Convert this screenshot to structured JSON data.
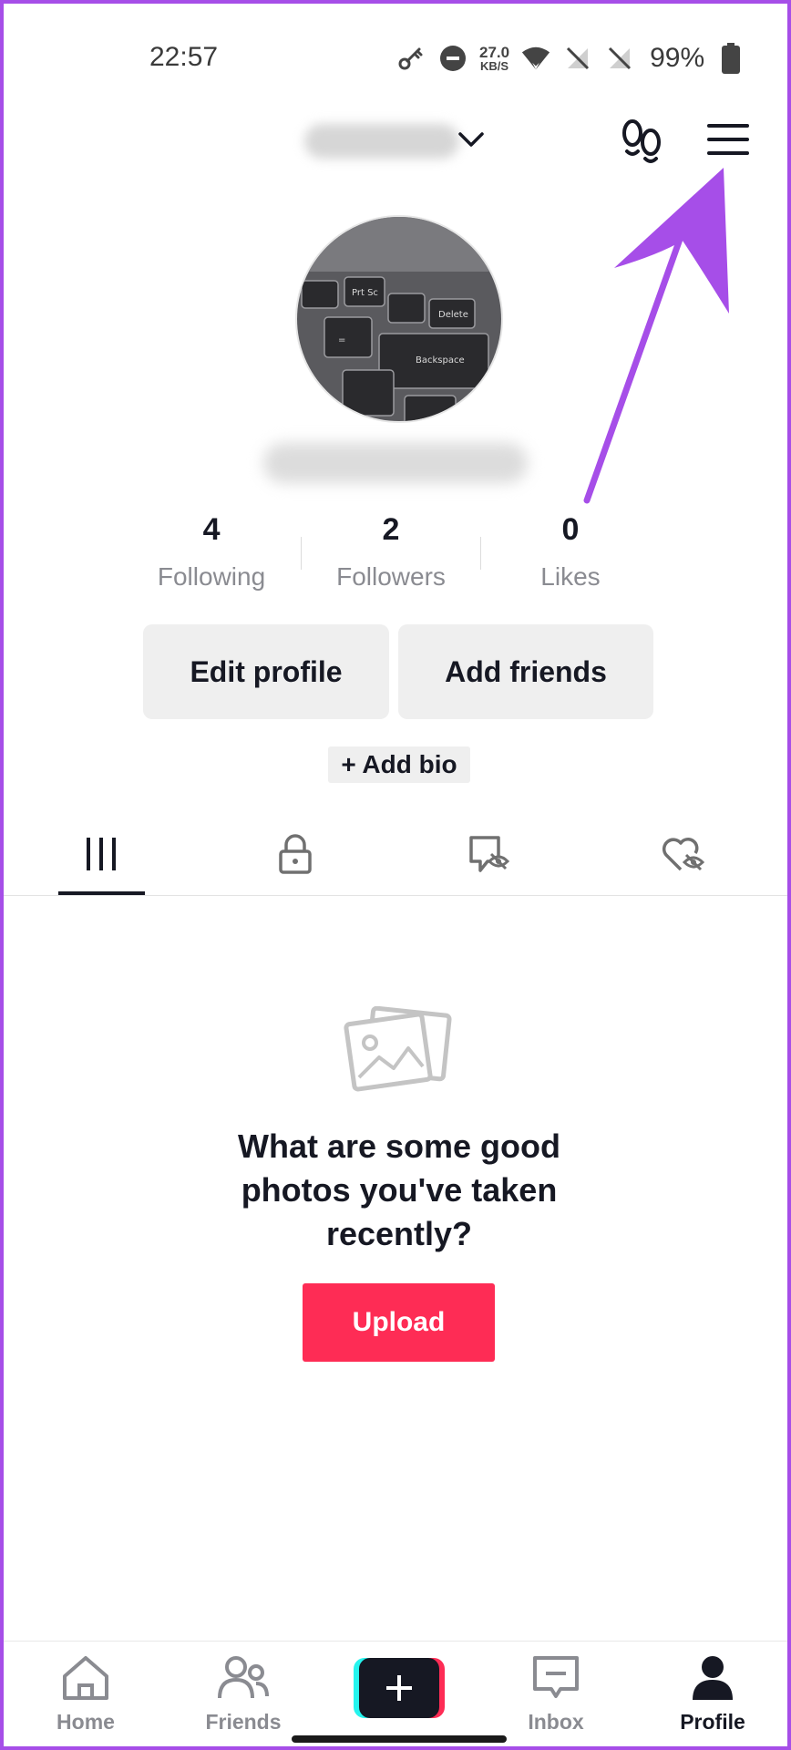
{
  "status_bar": {
    "time": "22:57",
    "network_speed_value": "27.0",
    "network_speed_unit": "KB/S",
    "battery": "99%"
  },
  "header": {
    "username": "username",
    "icons": [
      "chevron-down-icon",
      "footprints-icon",
      "menu-icon"
    ]
  },
  "profile": {
    "handle": "@handle"
  },
  "stats": [
    {
      "value": "4",
      "label": "Following"
    },
    {
      "value": "2",
      "label": "Followers"
    },
    {
      "value": "0",
      "label": "Likes"
    }
  ],
  "actions": {
    "edit_profile": "Edit profile",
    "add_friends": "Add friends",
    "add_bio": "+ Add bio"
  },
  "tabs": [
    {
      "icon": "grid-icon",
      "active": true
    },
    {
      "icon": "lock-icon",
      "active": false
    },
    {
      "icon": "reposts-hidden-icon",
      "active": false
    },
    {
      "icon": "liked-hidden-icon",
      "active": false
    }
  ],
  "empty_state": {
    "message": "What are some good photos you've taken recently?",
    "button": "Upload"
  },
  "bottom_nav": {
    "home": "Home",
    "friends": "Friends",
    "inbox": "Inbox",
    "profile": "Profile"
  },
  "colors": {
    "accent": "#fe2c55",
    "arrow": "#a64ee8",
    "border": "#a64ee8"
  }
}
